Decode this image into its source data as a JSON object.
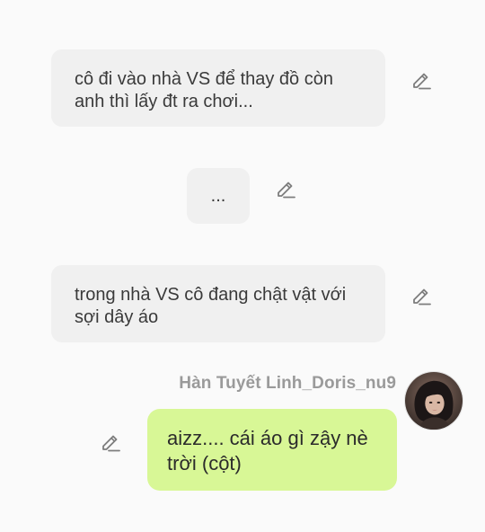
{
  "messages": [
    {
      "text": "cô đi vào nhà VS để thay đồ còn anh thì lấy đt ra chơi..."
    },
    {
      "text": "..."
    },
    {
      "text": "trong nhà VS cô đang chật vật với sợi dây áo"
    }
  ],
  "reply": {
    "sender": "Hàn Tuyết Linh_Doris_nu9",
    "text": "aizz.... cái áo gì zậy nè trời (cột)"
  },
  "icons": {
    "edit": "pencil-edit-icon",
    "avatar": "user-avatar"
  },
  "colors": {
    "background": "#fafafa",
    "bubble_gray": "#f0f0f0",
    "bubble_green": "#d8f796",
    "icon_gray": "#7d7d7d",
    "name_gray": "#9a9a9a"
  }
}
